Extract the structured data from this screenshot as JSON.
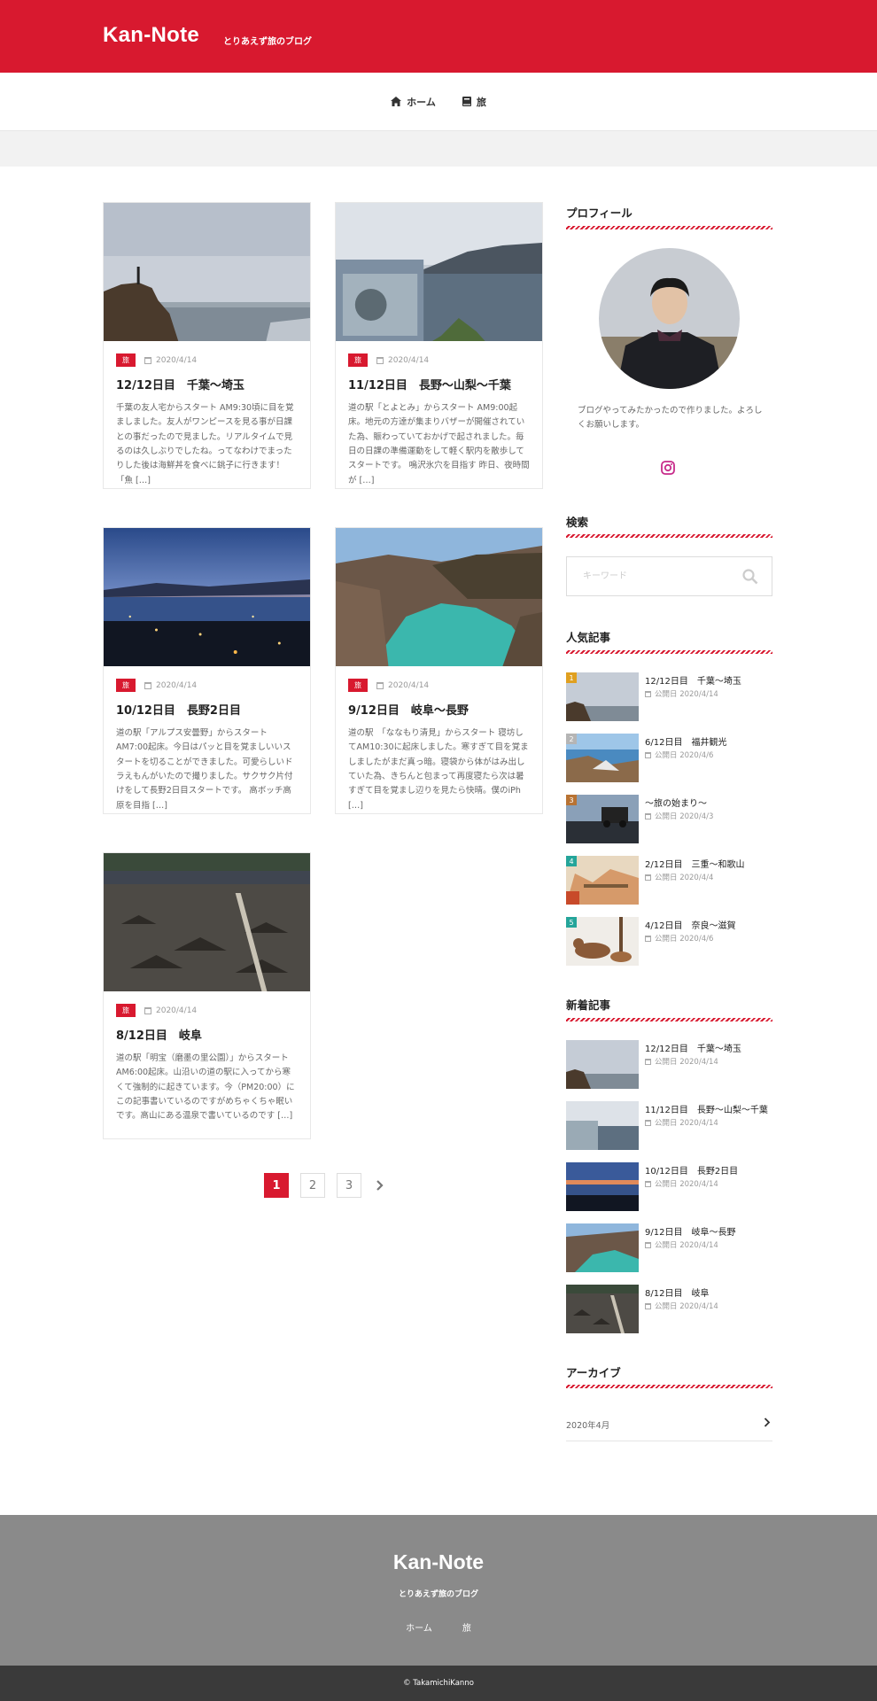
{
  "site": {
    "title": "Kan-Note",
    "tagline": "とりあえず旅のブログ"
  },
  "colors": {
    "accent": "#d8192f",
    "footer_bg": "#8a8a8a",
    "copyright_bg": "#3a3a3a"
  },
  "nav": [
    {
      "label": "ホーム",
      "icon": "home-icon"
    },
    {
      "label": "旅",
      "icon": "book-icon"
    }
  ],
  "posts": [
    {
      "category": "旅",
      "date": "2020/4/14",
      "title": "12/12日目　千葉〜埼玉",
      "excerpt": "千葉の友人宅からスタート AM9:30頃に目を覚ましました。友人がワンピースを見る事が日課との事だったので見ました。リアルタイムで見るのは久しぶりでしたね。ってなわけでまったりした後は海鮮丼を食べに銚子に行きます！「魚 […]"
    },
    {
      "category": "旅",
      "date": "2020/4/14",
      "title": "11/12日目　長野〜山梨〜千葉",
      "excerpt": "道の駅「とよとみ」からスタート AM9:00起床。地元の方達が集まりバザーが開催されていた為、賑わっていておかげで起されました。毎日の日課の準備運動をして軽く駅内を散歩してスタートです。 鳴沢氷穴を目指す 昨日、夜時間が […]"
    },
    {
      "category": "旅",
      "date": "2020/4/14",
      "title": "10/12日目　長野2日目",
      "excerpt": "道の駅「アルプス安曇野」からスタート AM7:00起床。今日はパッと目を覚ましいいスタートを切ることができました。可愛らしいドラえもんがいたので撮りました。サクサク片付けをして長野2日目スタートです。 高ボッチ高原を目指 […]"
    },
    {
      "category": "旅",
      "date": "2020/4/14",
      "title": "9/12日目　岐阜〜長野",
      "excerpt": "道の駅　「ななもり清見」からスタート 寝坊してAM10:30に起床しました。寒すぎて目を覚ましましたがまだ真っ暗。寝袋から体がはみ出していた為、きちんと包まって再度寝たら次は暑すぎて目を覚まし辺りを見たら快晴。僕のiPh […]"
    },
    {
      "category": "旅",
      "date": "2020/4/14",
      "title": "8/12日目　岐阜",
      "excerpt": "道の駅「明宝（磨墨の里公園）」からスタート AM6:00起床。山沿いの道の駅に入ってから寒くて強制的に起きています。今（PM20:00）にこの記事書いているのですがめちゃくちゃ眠いです。高山にある温泉で書いているのです […]"
    }
  ],
  "pagination": {
    "pages": [
      "1",
      "2",
      "3"
    ],
    "current": "1"
  },
  "sidebar": {
    "profile": {
      "heading": "プロフィール",
      "text": "ブログやってみたかったので作りました。よろしくお願いします。",
      "icon": "instagram-icon"
    },
    "search": {
      "heading": "検索",
      "placeholder": "キーワード"
    },
    "popular": {
      "heading": "人気記事",
      "items": [
        {
          "rank": "1",
          "title": "12/12日目　千葉〜埼玉",
          "date": "公開日 2020/4/14",
          "rank_color": "#e0a020"
        },
        {
          "rank": "2",
          "title": "6/12日目　福井観光",
          "date": "公開日 2020/4/6",
          "rank_color": "#b5b5b5"
        },
        {
          "rank": "3",
          "title": "〜旅の始まり〜",
          "date": "公開日 2020/4/3",
          "rank_color": "#b87333"
        },
        {
          "rank": "4",
          "title": "2/12日目　三重〜和歌山",
          "date": "公開日 2020/4/4",
          "rank_color": "#25a59a"
        },
        {
          "rank": "5",
          "title": "4/12日目　奈良〜滋賀",
          "date": "公開日 2020/4/6",
          "rank_color": "#25a59a"
        }
      ]
    },
    "recent": {
      "heading": "新着記事",
      "items": [
        {
          "title": "12/12日目　千葉〜埼玉",
          "date": "公開日 2020/4/14"
        },
        {
          "title": "11/12日目　長野〜山梨〜千葉",
          "date": "公開日 2020/4/14"
        },
        {
          "title": "10/12日目　長野2日目",
          "date": "公開日 2020/4/14"
        },
        {
          "title": "9/12日目　岐阜〜長野",
          "date": "公開日 2020/4/14"
        },
        {
          "title": "8/12日目　岐阜",
          "date": "公開日 2020/4/14"
        }
      ]
    },
    "archive": {
      "heading": "アーカイブ",
      "items": [
        "2020年4月"
      ]
    }
  },
  "footer": {
    "title": "Kan-Note",
    "tagline": "とりあえず旅のブログ",
    "nav": [
      "ホーム",
      "旅"
    ],
    "copyright": "© TakamichiKanno"
  }
}
